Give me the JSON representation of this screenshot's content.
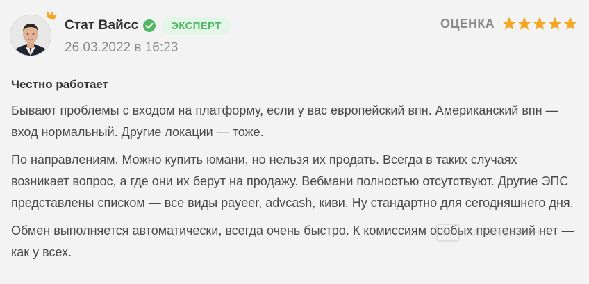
{
  "review": {
    "author": {
      "name": "Стат Вайсс",
      "badge": "ЭКСПЕРТ",
      "date": "26.03.2022 в 16:23"
    },
    "rating": {
      "label": "ОЦЕНКА",
      "stars": 5,
      "max_stars": 5
    },
    "title": "Честно работает",
    "paragraphs": [
      "Бывают проблемы с входом на платформу, если у вас европейский впн. Американский впн — вход нормальный. Другие локации — тоже.",
      "По направлениям. Можно купить юмани, но нельзя их продать. Всегда в таких случаях возникает вопрос, а где они их берут на продажу. Вебмани полностью отсутствуют. Другие ЭПС представлены списком — все виды payeer, advcash, киви. Ну стандартно для сегодняшнего дня.",
      "Обмен выполняется автоматически, всегда очень быстро. К комиссиям особых претензий нет — как у всех."
    ]
  },
  "watermark": {
    "text": "ПАРТНЕРКИН"
  },
  "colors": {
    "background": "#f3f3f3",
    "accent_green": "#52b765",
    "badge_bg": "#e4f6e8",
    "star": "#f5a623",
    "crown": "#f5a623"
  },
  "icons": {
    "crown": "crown-icon",
    "verified": "verified-check-icon",
    "star": "star-icon",
    "watermark": "partnerkin-logo-icon"
  }
}
